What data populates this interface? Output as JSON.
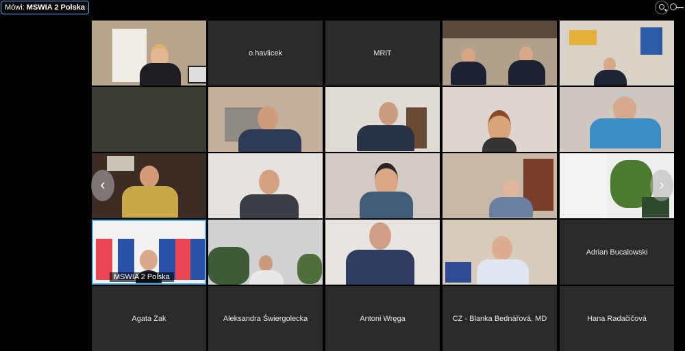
{
  "top_bar": {
    "speaker_prefix": "Mówi:",
    "speaker_name": "MSWIA 2 Polska",
    "zoom_icon": "magnifier-icon"
  },
  "nav": {
    "prev_icon": "chevron-left-icon",
    "next_icon": "chevron-right-icon",
    "prev_glyph": "‹",
    "next_glyph": "›"
  },
  "tiles": {
    "r1c1": "",
    "r1c2": "o.havlicek",
    "r1c3": "MRiT",
    "r4c1_caption": "MSWIA 2 Polska",
    "r4c5": "Adrian Bucalowski",
    "r5c1": "Agata Żak",
    "r5c2": "Aleksandra Świergolecka",
    "r5c3": "Antoni Wręga",
    "r5c4": "CZ - Blanka Bednářová, MD",
    "r5c5": "Hana Radačičová"
  },
  "colors": {
    "active_border": "#55b4ea",
    "tile_bg": "#2a2a2a",
    "speaker_border": "#6aa9e8"
  }
}
